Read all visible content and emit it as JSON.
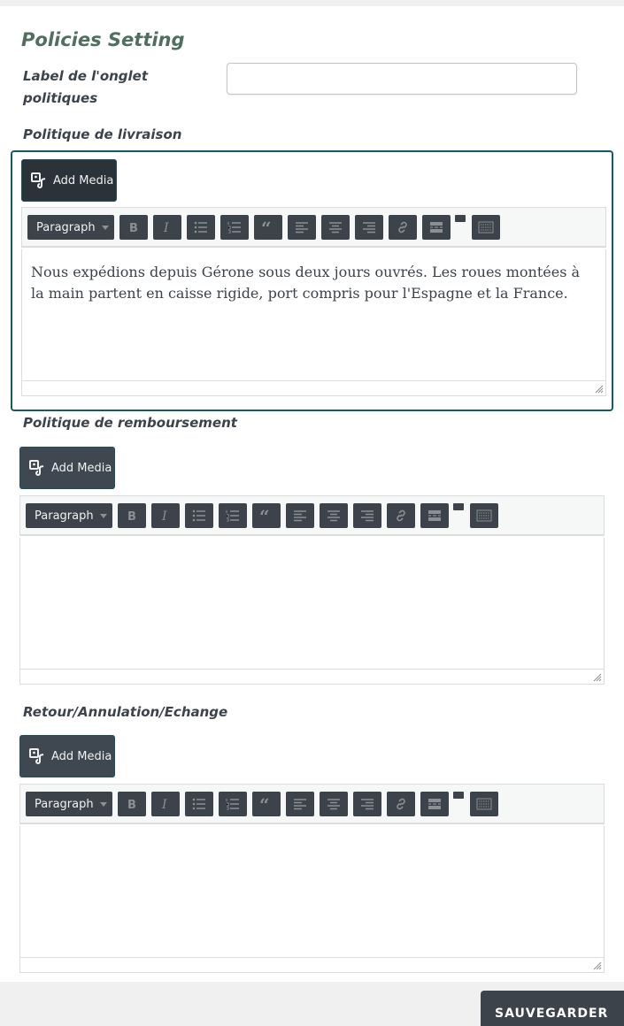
{
  "page": {
    "title": "Policies Setting"
  },
  "tab_label": {
    "label": "Label de l'onglet politiques",
    "value": "",
    "placeholder": ""
  },
  "editors": [
    {
      "label": "Politique de livraison",
      "add_media": "Add Media",
      "format": "Paragraph",
      "content": "Nous expédions depuis Gérone sous deux jours ouvrés. Les roues montées à la main partent en caisse rigide, port compris pour l'Espagne et la France."
    },
    {
      "label": "Politique de remboursement",
      "add_media": "Add Media",
      "format": "Paragraph",
      "content": ""
    },
    {
      "label": "Retour/Annulation/Echange",
      "add_media": "Add Media",
      "format": "Paragraph",
      "content": ""
    }
  ],
  "toolbar_icons": [
    "bold-icon",
    "italic-icon",
    "bullet-list-icon",
    "numbered-list-icon",
    "blockquote-icon",
    "align-left-icon",
    "align-center-icon",
    "align-right-icon",
    "link-icon",
    "read-more-icon",
    "toolbar-toggle-icon"
  ],
  "save": {
    "label": "SAUVEGARDER"
  },
  "colors": {
    "title": "#4f6f5f",
    "focus_border": "#0f5e63",
    "button_dark": "#3c434a"
  }
}
